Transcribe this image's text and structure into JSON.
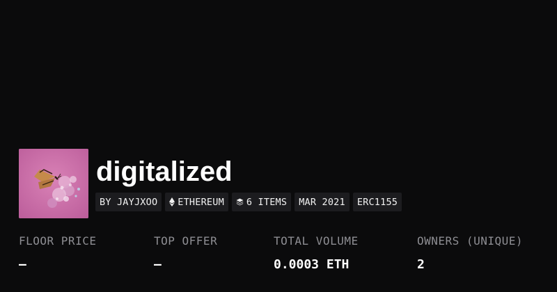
{
  "collection": {
    "title": "digitalized",
    "image_icon": "butterfly-on-flowers-thumbnail"
  },
  "tags": {
    "creator": "BY JAYJXOO",
    "chain": "ETHEREUM",
    "chain_icon": "ethereum-icon",
    "items": "6 ITEMS",
    "items_icon": "layers-icon",
    "date": "MAR 2021",
    "standard": "ERC1155"
  },
  "stats": {
    "floor_price": {
      "label": "FLOOR PRICE",
      "value": "—"
    },
    "top_offer": {
      "label": "TOP OFFER",
      "value": "—"
    },
    "total_volume": {
      "label": "TOTAL VOLUME",
      "value": "0.0003 ETH"
    },
    "owners": {
      "label": "OWNERS (UNIQUE)",
      "value": "2"
    }
  },
  "colors": {
    "background": "#0b0b0c",
    "tag_background": "#1c1c1f",
    "label_gray": "#8e8e93",
    "text": "#ffffff",
    "thumbnail_pink": "#c86aa4"
  }
}
